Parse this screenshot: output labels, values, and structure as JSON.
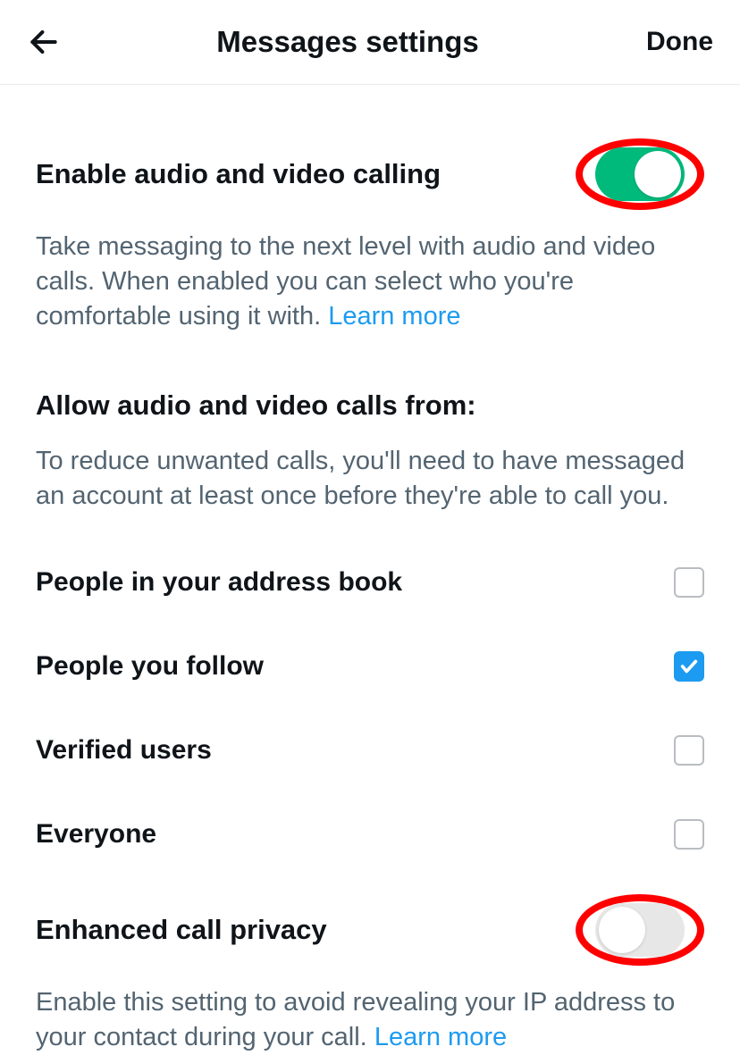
{
  "header": {
    "title": "Messages settings",
    "done_label": "Done"
  },
  "enable_calling": {
    "title": "Enable audio and video calling",
    "description": "Take messaging to the next level with audio and video calls. When enabled you can select who you're comfortable using it with. ",
    "learn_more": "Learn more",
    "toggle_on": true
  },
  "allow_from": {
    "title": "Allow audio and video calls from:",
    "description": "To reduce unwanted calls, you'll need to have messaged an account at least once before they're able to call you.",
    "options": [
      {
        "label": "People in your address book",
        "checked": false
      },
      {
        "label": "People you follow",
        "checked": true
      },
      {
        "label": "Verified users",
        "checked": false
      },
      {
        "label": "Everyone",
        "checked": false
      }
    ]
  },
  "enhanced_privacy": {
    "title": "Enhanced call privacy",
    "description": "Enable this setting to avoid revealing your IP address to your contact during your call. ",
    "learn_more": "Learn more",
    "toggle_on": false
  }
}
